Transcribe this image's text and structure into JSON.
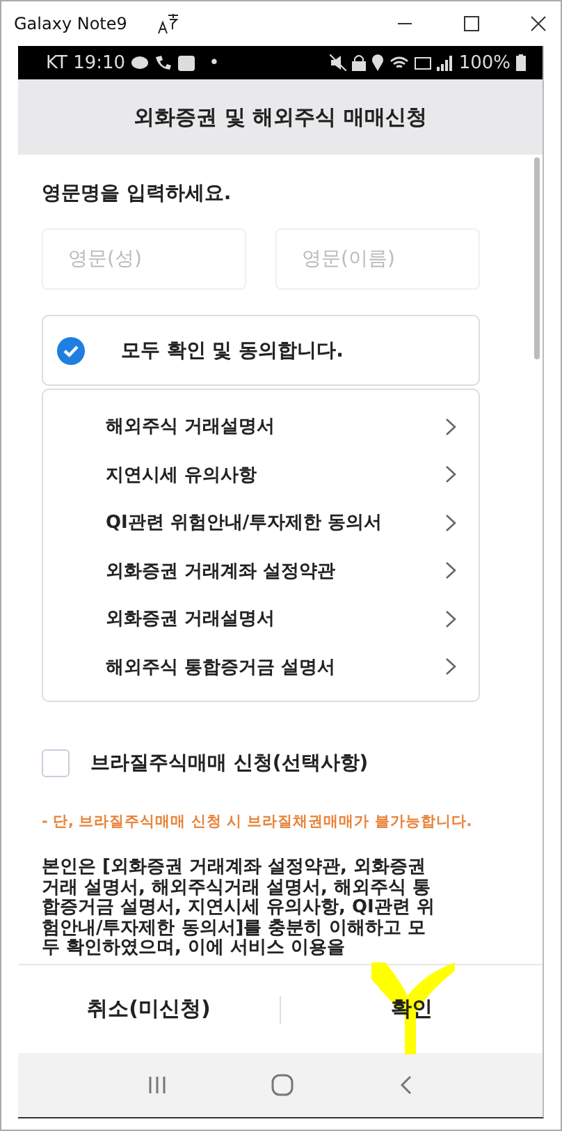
{
  "window": {
    "title": "Galaxy Note9"
  },
  "status_bar": {
    "carrier_time": "KT 19:10",
    "dot": "•",
    "battery": "100%"
  },
  "header": {
    "title": "외화증권 및 해외주식 매매신청"
  },
  "name_form": {
    "label": "영문명을 입력하세요.",
    "fields": [
      {
        "placeholder": "영문(성)"
      },
      {
        "placeholder": "영문(이름)"
      }
    ]
  },
  "agree_all": {
    "label": "모두 확인 및 동의합니다.",
    "checked": true
  },
  "documents": [
    {
      "label": "해외주식 거래설명서"
    },
    {
      "label": "지연시세 유의사항"
    },
    {
      "label": "QI관련 위험안내/투자제한 동의서"
    },
    {
      "label": "외화증권 거래계좌 설정약관"
    },
    {
      "label": "외화증권 거래설명서"
    },
    {
      "label": "해외주식 통합증거금 설명서"
    }
  ],
  "brazil_option": {
    "label": "브라질주식매매 신청(선택사항)",
    "checked": false
  },
  "notice": "- 단, 브라질주식매매 신청 시 브라질채권매매가 불가능합니다.",
  "statement": "본인은 [외화증권 거래계좌 설정약관, 외화증권거래 설명서, 해외주식거래 설명서, 해외주식 통합증거금 설명서, 지연시세 유의사항, QI관련 위험안내/투자제한 동의서]를 충분히 이해하고 모두 확인하였으며, 이에 서비스 이용을",
  "buttons": [
    {
      "label": "취소(미신청)"
    },
    {
      "label": "확인"
    }
  ]
}
